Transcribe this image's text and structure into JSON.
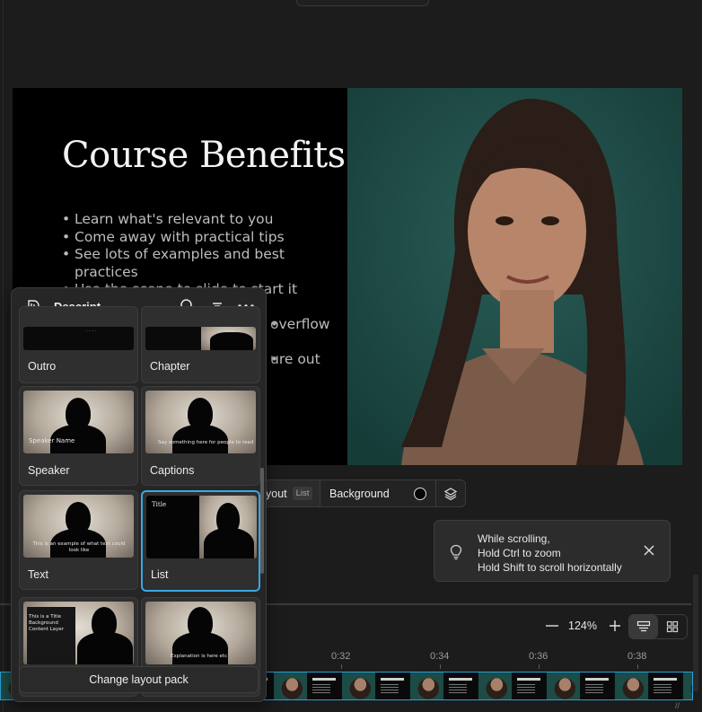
{
  "slide": {
    "title": "Course Benefits",
    "bullets": [
      "Learn what's relevant to you",
      "Come away with practical tips",
      "See lots of examples and best practices",
      "Use the scene to slide to start it",
      "overflow",
      "ure out"
    ]
  },
  "toolbar": {
    "layout_label": "yout",
    "layout_badge": "List",
    "background_label": "Background",
    "background_color": "#050505"
  },
  "scroll_hint": {
    "line1": "While scrolling,",
    "line2": "Hold Ctrl to zoom",
    "line3": "Hold Shift to scroll horizontally"
  },
  "zoom": {
    "value": "124%"
  },
  "timeline": {
    "ticks": [
      "0:32",
      "0:34",
      "0:36",
      "0:38"
    ]
  },
  "panel": {
    "title": "Descript",
    "layouts": [
      {
        "label": "Outro"
      },
      {
        "label": "Chapter"
      },
      {
        "label": "Speaker",
        "caption": "Speaker Name"
      },
      {
        "label": "Captions",
        "caption": "Say something here for people to read"
      },
      {
        "label": "Text",
        "caption": "This is an example of what text could look like"
      },
      {
        "label": "List",
        "caption": "Title"
      },
      {
        "label": "",
        "caption": "This is a Title Background Content Layer"
      },
      {
        "label": "",
        "caption": "Explanation is here etc"
      }
    ],
    "change_button": "Change layout pack"
  },
  "colors": {
    "accent": "#3aa8e0",
    "canvas_bg": "#000000",
    "photo_bg": "#1d4b46"
  }
}
